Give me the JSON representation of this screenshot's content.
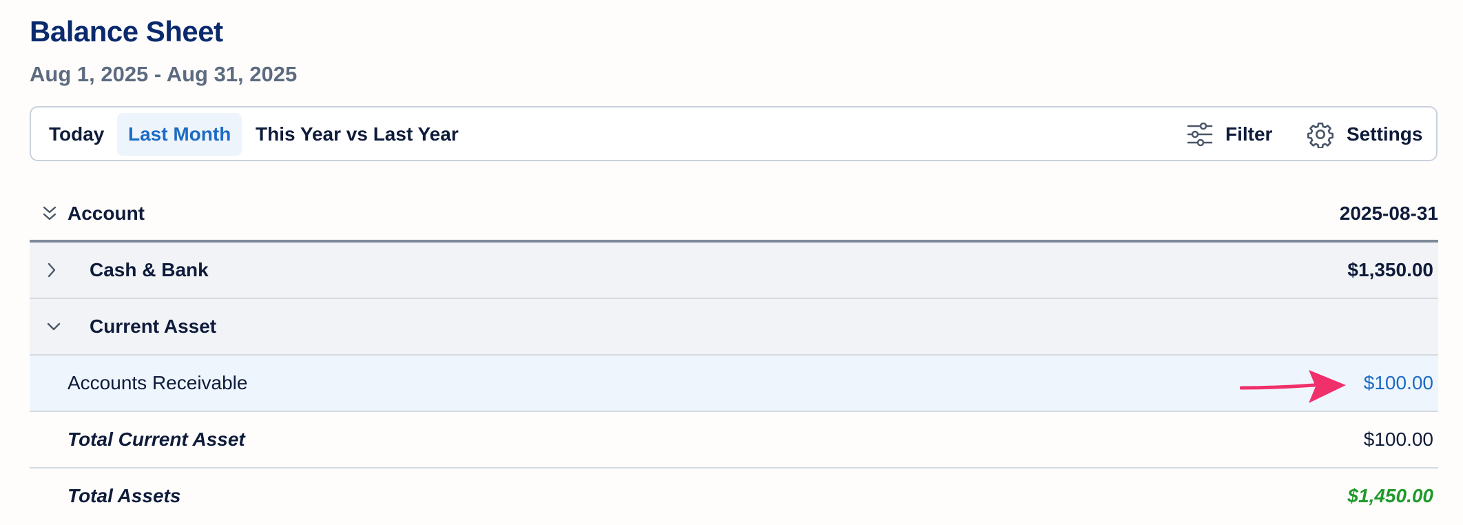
{
  "header": {
    "title": "Balance Sheet",
    "date_range": "Aug 1, 2025 - Aug 31, 2025"
  },
  "toolbar": {
    "tabs": [
      {
        "label": "Today",
        "active": false
      },
      {
        "label": "Last Month",
        "active": true
      },
      {
        "label": "This Year vs Last Year",
        "active": false
      }
    ],
    "filter_label": "Filter",
    "filter_icon": "sliders-icon",
    "settings_label": "Settings",
    "settings_icon": "gear-icon"
  },
  "table": {
    "column_account": "Account",
    "column_date": "2025-08-31",
    "rows": [
      {
        "type": "group",
        "label": "Cash & Bank",
        "amount": "$1,350.00",
        "expanded": false
      },
      {
        "type": "group",
        "label": "Current Asset",
        "amount": "",
        "expanded": true
      },
      {
        "type": "child",
        "label": "Accounts Receivable",
        "amount": "$100.00",
        "selected": true
      },
      {
        "type": "total",
        "label": "Total Current Asset",
        "amount": "$100.00"
      },
      {
        "type": "total",
        "label": "Total Assets",
        "amount": "$1,450.00"
      }
    ]
  },
  "colors": {
    "title": "#0b2a6e",
    "accent_link": "#1c6bc4",
    "positive_total": "#1f9a2a",
    "annotation_arrow": "#f0306a"
  }
}
